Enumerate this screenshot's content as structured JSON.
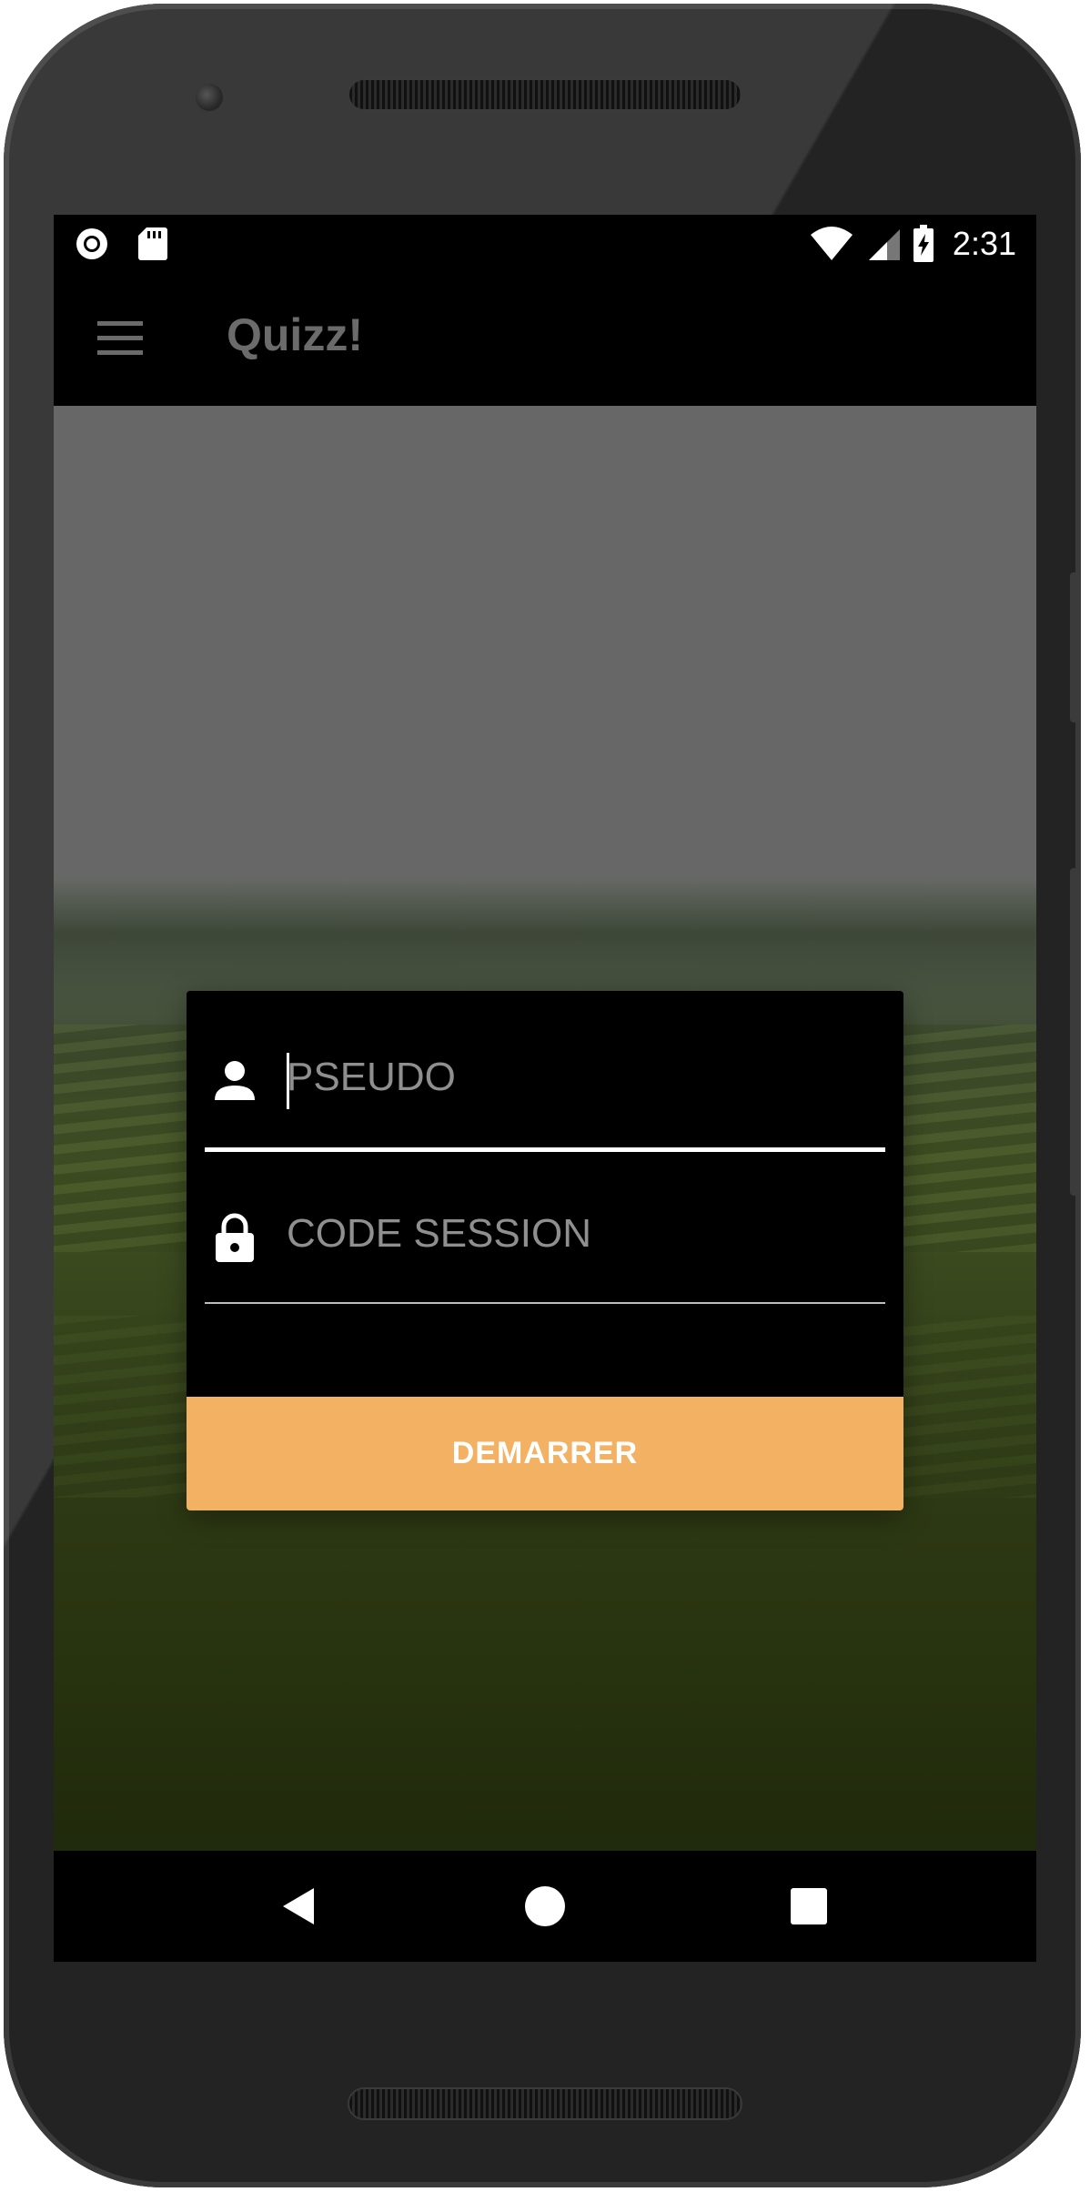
{
  "status_bar": {
    "time": "2:31",
    "left_icons": [
      "record-icon",
      "sd-card-icon"
    ],
    "right_icons": [
      "wifi-icon",
      "cell-signal-icon",
      "battery-charging-icon"
    ]
  },
  "app_bar": {
    "title": "Quizz!",
    "menu_icon": "hamburger-menu-icon"
  },
  "login_form": {
    "pseudo": {
      "value": "",
      "placeholder": "PSEUDO",
      "icon": "person-icon"
    },
    "code_session": {
      "value": "",
      "placeholder": "CODE SESSION",
      "icon": "lock-icon"
    },
    "start_button_label": "DEMARRER"
  },
  "nav_bar": {
    "buttons": [
      "back-icon",
      "home-icon",
      "recents-icon"
    ]
  },
  "colors": {
    "accent": "#f3b263",
    "app_bar_bg": "#000000",
    "title_text": "#6b6b6b",
    "card_bg": "#000000"
  }
}
